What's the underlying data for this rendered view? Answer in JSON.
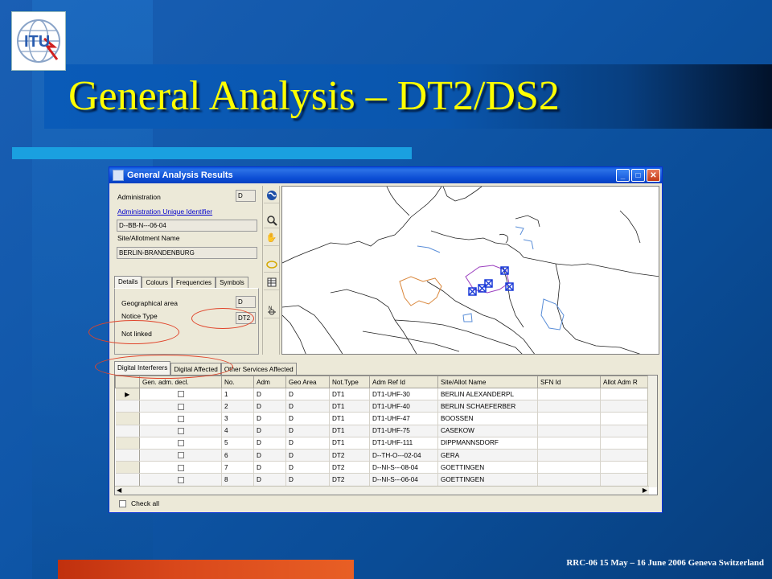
{
  "slide": {
    "title": "General Analysis – DT2/DS2",
    "footer": "RRC-06 15 May – 16 June 2006 Geneva Switzerland",
    "logo_text": "ITU",
    "colors": {
      "title": "#ffff00",
      "background": "#0f56a8",
      "accent_strip": "#1aa0e0",
      "bottom_bar": "#d9481b",
      "highlight_ellipse": "#e0442a"
    }
  },
  "window": {
    "title": "General Analysis Results",
    "controls": [
      "minimize",
      "maximize",
      "close"
    ]
  },
  "details": {
    "administration_label": "Administration",
    "administration_value": "D",
    "admin_uid_link": "Administration Unique Identifier",
    "admin_uid_value": "D--BB-N---06-04",
    "site_label": "Site/Allotment Name",
    "site_value": "BERLIN-BRANDENBURG",
    "tabs": [
      "Details",
      "Colours",
      "Frequencies",
      "Symbols"
    ],
    "active_tab": "Details",
    "geo_area_label": "Geographical area",
    "geo_area_value": "D",
    "notice_type_label": "Notice Type",
    "notice_type_value": "DT2",
    "link_status": "Not linked"
  },
  "toolbar": {
    "icons": [
      "globe-icon",
      "zoom-icon",
      "hand-icon",
      "ellipse-icon",
      "table-icon",
      "compass-icon"
    ]
  },
  "results": {
    "tabs": [
      "Digital Interferers",
      "Digital Affected",
      "Other Services Affected"
    ],
    "active_tab": "Digital Interferers",
    "columns": [
      "Gen. adm. decl.",
      "No.",
      "Adm",
      "Geo Area",
      "Not.Type",
      "Adm Ref Id",
      "Site/Allot Name",
      "SFN Id",
      "Allot Adm R"
    ],
    "rows": [
      {
        "no": "1",
        "adm": "D",
        "geo": "D",
        "type": "DT1",
        "ref": "DT1-UHF-30",
        "site": "BERLIN ALEXANDERPL",
        "sfn": "",
        "allot": ""
      },
      {
        "no": "2",
        "adm": "D",
        "geo": "D",
        "type": "DT1",
        "ref": "DT1-UHF-40",
        "site": "BERLIN SCHAEFERBER",
        "sfn": "",
        "allot": ""
      },
      {
        "no": "3",
        "adm": "D",
        "geo": "D",
        "type": "DT1",
        "ref": "DT1-UHF-47",
        "site": "BOOSSEN",
        "sfn": "",
        "allot": ""
      },
      {
        "no": "4",
        "adm": "D",
        "geo": "D",
        "type": "DT1",
        "ref": "DT1-UHF-75",
        "site": "CASEKOW",
        "sfn": "",
        "allot": ""
      },
      {
        "no": "5",
        "adm": "D",
        "geo": "D",
        "type": "DT1",
        "ref": "DT1-UHF-111",
        "site": "DIPPMANNSDORF",
        "sfn": "",
        "allot": ""
      },
      {
        "no": "6",
        "adm": "D",
        "geo": "D",
        "type": "DT2",
        "ref": "D--TH-O---02-04",
        "site": "GERA",
        "sfn": "",
        "allot": ""
      },
      {
        "no": "7",
        "adm": "D",
        "geo": "D",
        "type": "DT2",
        "ref": "D--NI-S---08-04",
        "site": "GOETTINGEN",
        "sfn": "",
        "allot": ""
      },
      {
        "no": "8",
        "adm": "D",
        "geo": "D",
        "type": "DT2",
        "ref": "D--NI-S---06-04",
        "site": "GOETTINGEN",
        "sfn": "",
        "allot": ""
      }
    ],
    "check_all_label": "Check all"
  }
}
